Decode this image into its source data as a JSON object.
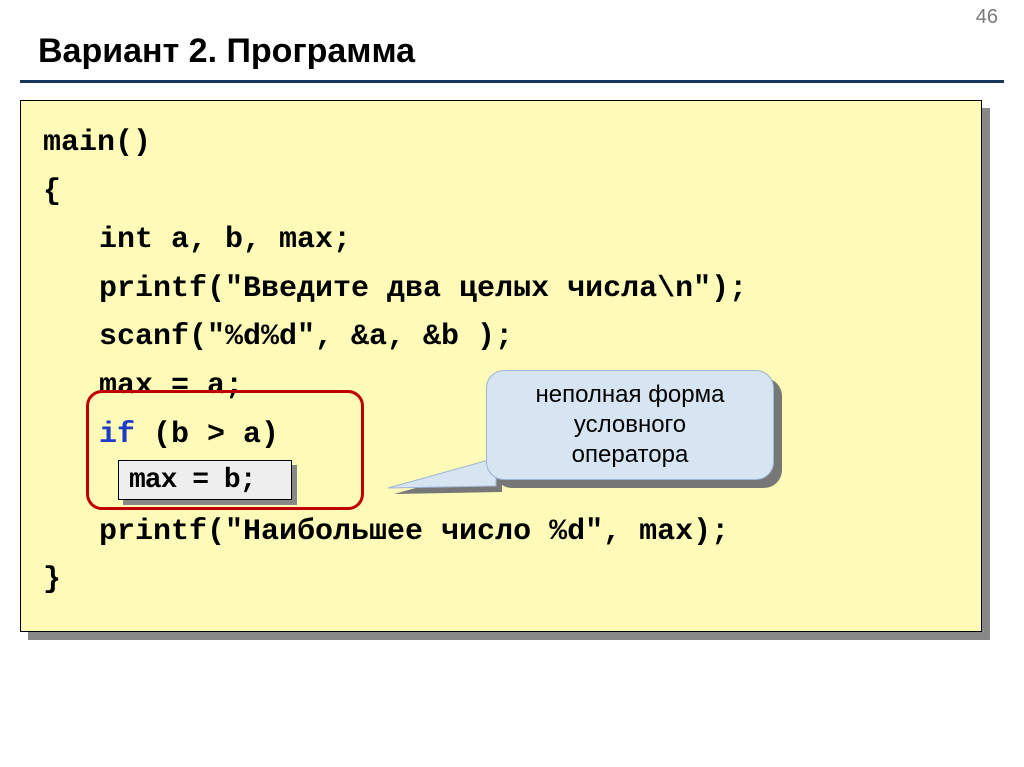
{
  "page_number": "46",
  "title": "Вариант 2. Программа",
  "code": {
    "l1": "main()",
    "l2": "{",
    "l3": "int a, b, max;",
    "l4": "printf(\"Введите два целых числа\\n\");",
    "l5": "scanf(\"%d%d\", &a, &b );",
    "l6": "max = a;",
    "l7_kw": "if",
    "l7_rest": " (b > a)",
    "l8_highlight": "max = b;",
    "l9": "printf(\"Наибольшее число %d\", max);",
    "l10": "}"
  },
  "callout": {
    "line1": "неполная форма",
    "line2": "условного",
    "line3": "оператора"
  }
}
